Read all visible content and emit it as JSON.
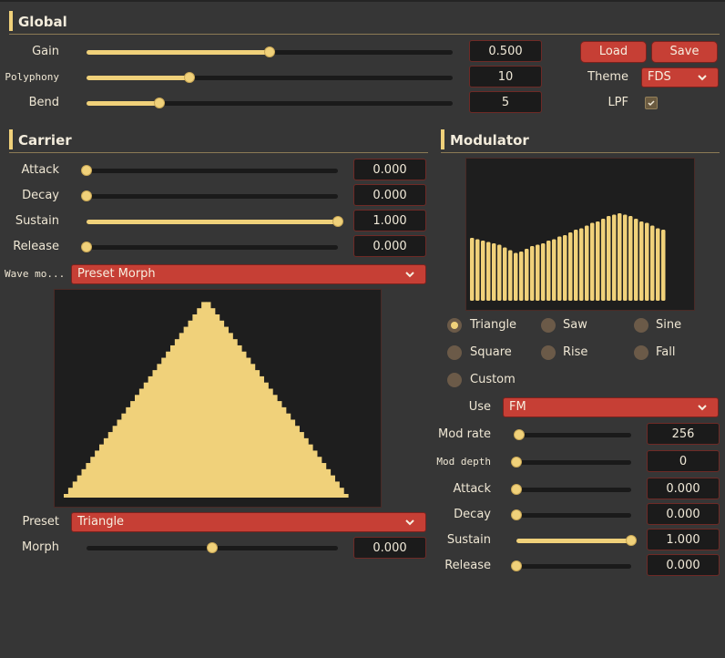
{
  "global": {
    "title": "Global",
    "gain": {
      "label": "Gain",
      "value": "0.500",
      "fraction": 0.5
    },
    "polyphony": {
      "label": "Polyphony",
      "value": "10",
      "fraction": 0.28
    },
    "bend": {
      "label": "Bend",
      "value": "5",
      "fraction": 0.2
    },
    "load_label": "Load",
    "save_label": "Save",
    "theme_label": "Theme",
    "theme_value": "FDS",
    "lpf_label": "LPF",
    "lpf_checked": true
  },
  "carrier": {
    "title": "Carrier",
    "attack": {
      "label": "Attack",
      "value": "0.000",
      "fraction": 0
    },
    "decay": {
      "label": "Decay",
      "value": "0.000",
      "fraction": 0
    },
    "sustain": {
      "label": "Sustain",
      "value": "1.000",
      "fraction": 1
    },
    "release": {
      "label": "Release",
      "value": "0.000",
      "fraction": 0
    },
    "wave_mode_label": "Wave mo...",
    "wave_mode_value": "Preset Morph",
    "preset_label": "Preset",
    "preset_value": "Triangle",
    "morph": {
      "label": "Morph",
      "value": "0.000",
      "fraction": 0.5
    },
    "waveform_shape": "triangle"
  },
  "modulator": {
    "title": "Modulator",
    "waveform_shape": "custom-bars",
    "radios": [
      {
        "label": "Triangle",
        "selected": true
      },
      {
        "label": "Saw",
        "selected": false
      },
      {
        "label": "Sine",
        "selected": false
      },
      {
        "label": "Square",
        "selected": false
      },
      {
        "label": "Rise",
        "selected": false
      },
      {
        "label": "Fall",
        "selected": false
      },
      {
        "label": "Custom",
        "selected": false
      }
    ],
    "use_label": "Use",
    "use_value": "FM",
    "mod_rate": {
      "label": "Mod rate",
      "value": "256",
      "fraction": 0.02
    },
    "mod_depth": {
      "label": "Mod depth",
      "value": "0",
      "fraction": 0
    },
    "attack": {
      "label": "Attack",
      "value": "0.000",
      "fraction": 0
    },
    "decay": {
      "label": "Decay",
      "value": "0.000",
      "fraction": 0
    },
    "sustain": {
      "label": "Sustain",
      "value": "1.000",
      "fraction": 1
    },
    "release": {
      "label": "Release",
      "value": "0.000",
      "fraction": 0
    }
  },
  "colors": {
    "accent": "#f0d17a",
    "button": "#c63f35",
    "background": "#363636",
    "panel": "#1e1e1e"
  }
}
